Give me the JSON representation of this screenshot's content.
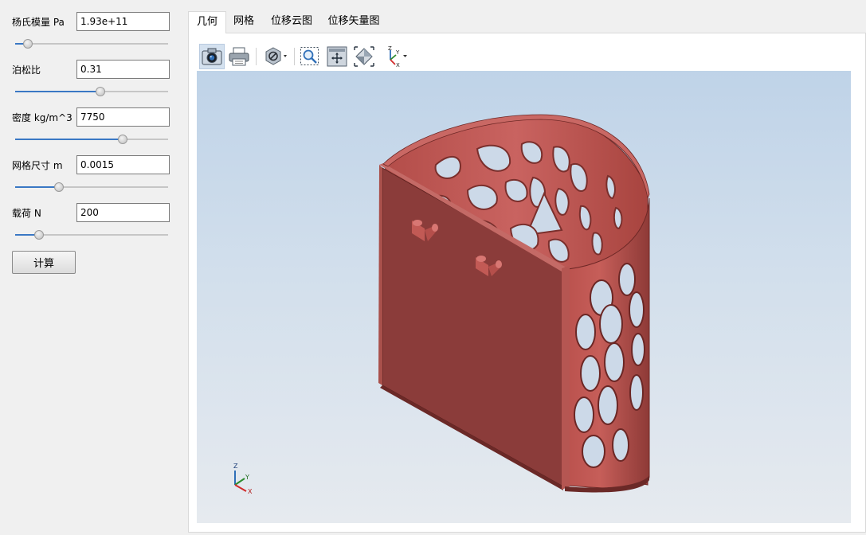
{
  "params": [
    {
      "label": "杨氏模量 Pa",
      "value": "1.93e+11",
      "slider": 0.08
    },
    {
      "label": "泊松比",
      "value": "0.31",
      "slider": 0.55
    },
    {
      "label": "密度 kg/m^3",
      "value": "7750",
      "slider": 0.7
    },
    {
      "label": "网格尺寸 m",
      "value": "0.0015",
      "slider": 0.28
    },
    {
      "label": "载荷 N",
      "value": "200",
      "slider": 0.15
    }
  ],
  "calculate_label": "计算",
  "tabs": [
    {
      "label": "几何",
      "active": true
    },
    {
      "label": "网格",
      "active": false
    },
    {
      "label": "位移云图",
      "active": false
    },
    {
      "label": "位移矢量图",
      "active": false
    }
  ],
  "toolbar_icons": [
    "camera-icon",
    "print-icon",
    "display-mode-icon",
    "zoom-box-icon",
    "fit-all-icon",
    "view-iso-icon",
    "view-axis-icon"
  ],
  "triad": {
    "x": "X",
    "y": "Y",
    "z": "Z"
  },
  "colors": {
    "model": "#8b3c3a",
    "model_light": "#c45a55",
    "accent": "#3a78c4"
  }
}
